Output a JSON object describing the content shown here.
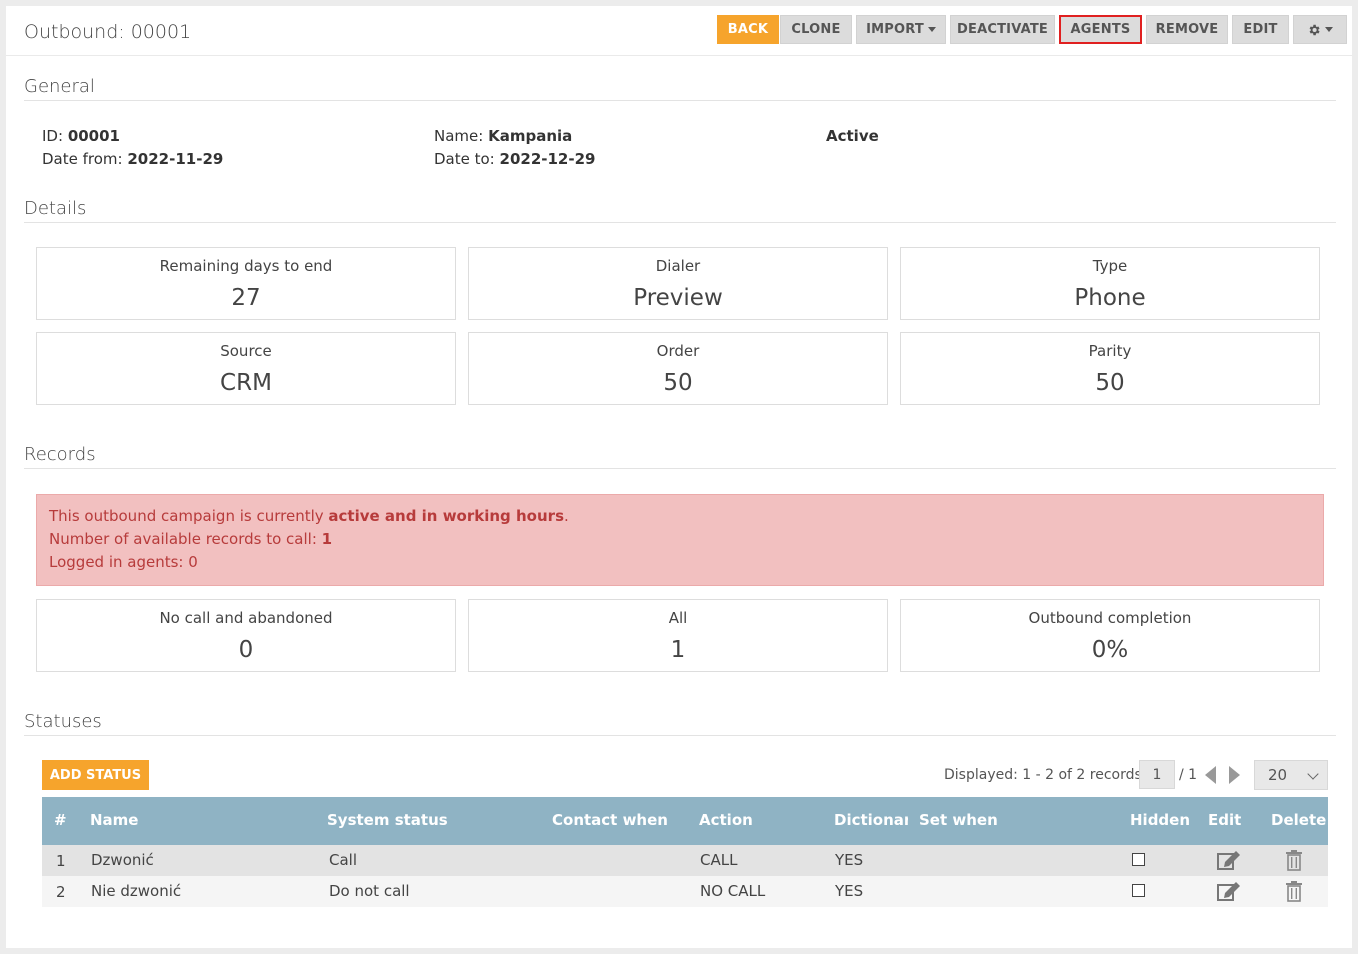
{
  "header": {
    "title": "Outbound: 00001",
    "buttons": {
      "back": "BACK",
      "clone": "CLONE",
      "import": "IMPORT",
      "deactivate": "DEACTIVATE",
      "agents": "AGENTS",
      "remove": "REMOVE",
      "edit": "EDIT"
    }
  },
  "general": {
    "title": "General",
    "id_label": "ID:",
    "id_value": "00001",
    "date_from_label": "Date from:",
    "date_from_value": "2022-11-29",
    "name_label": "Name:",
    "name_value": "Kampania",
    "date_to_label": "Date to:",
    "date_to_value": "2022-12-29",
    "status": "Active"
  },
  "details": {
    "title": "Details",
    "boxes": [
      {
        "label": "Remaining days to end",
        "value": "27"
      },
      {
        "label": "Dialer",
        "value": "Preview"
      },
      {
        "label": "Type",
        "value": "Phone"
      },
      {
        "label": "Source",
        "value": "CRM"
      },
      {
        "label": "Order",
        "value": "50"
      },
      {
        "label": "Parity",
        "value": "50"
      }
    ]
  },
  "records": {
    "title": "Records",
    "alert": {
      "line1_prefix": "This outbound campaign is currently ",
      "line1_bold": "active and in working hours",
      "line1_suffix": ".",
      "line2_prefix": "Number of available records to call: ",
      "line2_bold": "1",
      "line3": "Logged in agents: 0"
    },
    "boxes": [
      {
        "label": "No call and abandoned",
        "value": "0"
      },
      {
        "label": "All",
        "value": "1"
      },
      {
        "label": "Outbound completion",
        "value": "0%"
      }
    ]
  },
  "statuses": {
    "title": "Statuses",
    "add_button": "ADD STATUS",
    "pager_text": "Displayed: 1 - 2 of 2 records",
    "page_value": "1",
    "page_total": "/ 1",
    "per_page": "20",
    "columns": [
      "#",
      "Name",
      "System status",
      "Contact when",
      "Action",
      "Dictionary",
      "Set when",
      "Hidden",
      "Edit",
      "Delete"
    ],
    "rows": [
      {
        "num": "1",
        "name": "Dzwonić",
        "system_status": "Call",
        "contact_when": "",
        "action": "CALL",
        "dictionary": "YES",
        "set_when": "",
        "hidden": false
      },
      {
        "num": "2",
        "name": "Nie dzwonić",
        "system_status": "Do not call",
        "contact_when": "",
        "action": "NO CALL",
        "dictionary": "YES",
        "set_when": "",
        "hidden": false
      }
    ]
  },
  "colors": {
    "accent": "#f6a42c",
    "table_header": "#8fb3c4",
    "alert_bg": "#f2c0c0",
    "alert_text": "#b73b3b",
    "highlight_border": "#e02020"
  },
  "icons": [
    "caret-down-icon",
    "gear-icon",
    "arrow-left-icon",
    "arrow-right-icon",
    "chevron-down-icon",
    "checkbox-icon",
    "edit-icon",
    "trash-icon"
  ]
}
